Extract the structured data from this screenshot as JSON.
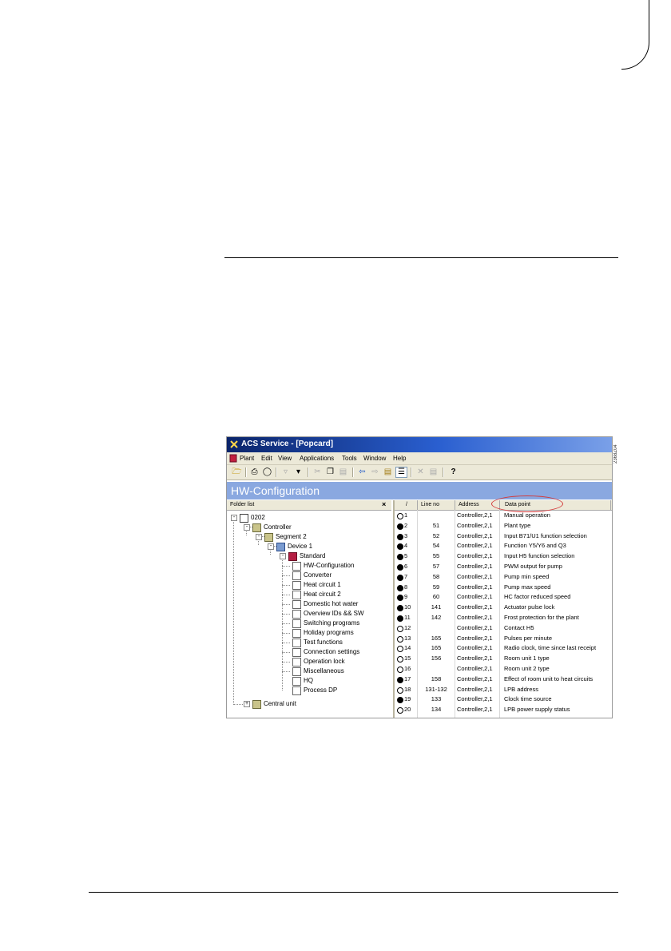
{
  "page": {
    "side_code": "2368Z04"
  },
  "window": {
    "title": "ACS Service - [Popcard]"
  },
  "menu": [
    "Plant",
    "Edit",
    "View",
    "Applications",
    "Tools",
    "Window",
    "Help"
  ],
  "toolbar_icons": [
    "open-icon",
    "print-icon",
    "print-preview-icon",
    "filter-icon",
    "filter-remove-icon",
    "cut-icon",
    "copy-icon",
    "paste-icon",
    "back-icon",
    "forward-icon",
    "folder-up-icon",
    "details-view-icon",
    "delete-icon",
    "properties-icon",
    "help-icon"
  ],
  "view": {
    "header": "HW-Configuration"
  },
  "folder_list": {
    "label": "Folder list",
    "close_glyph": "×",
    "nodes": [
      {
        "label": "0202",
        "icon": "plant"
      },
      {
        "label": "Controller",
        "icon": "ctrl"
      },
      {
        "label": "Segment 2",
        "icon": "ctrl"
      },
      {
        "label": "Device 1",
        "icon": "dev"
      },
      {
        "label": "Standard",
        "icon": "std"
      },
      {
        "label": "HW-Configuration",
        "icon": "page"
      },
      {
        "label": "Converter",
        "icon": "page"
      },
      {
        "label": "Heat circuit 1",
        "icon": "page"
      },
      {
        "label": "Heat circuit 2",
        "icon": "page"
      },
      {
        "label": "Domestic hot water",
        "icon": "page"
      },
      {
        "label": "Overview IDs && SW",
        "icon": "page"
      },
      {
        "label": "Switching programs",
        "icon": "page"
      },
      {
        "label": "Holiday programs",
        "icon": "page"
      },
      {
        "label": "Test functions",
        "icon": "page"
      },
      {
        "label": "Connection settings",
        "icon": "page"
      },
      {
        "label": "Operation lock",
        "icon": "page"
      },
      {
        "label": "Miscellaneous",
        "icon": "page"
      },
      {
        "label": "HQ",
        "icon": "page"
      },
      {
        "label": "Process DP",
        "icon": "page"
      },
      {
        "label": "Central unit",
        "icon": "ctrl"
      }
    ]
  },
  "grid": {
    "columns": [
      "/",
      "Line no",
      "Address",
      "Data point"
    ],
    "rows": [
      {
        "filled": false,
        "idx": "1",
        "line": "",
        "addr": "Controller,2,1",
        "dp": "Manual operation"
      },
      {
        "filled": true,
        "idx": "2",
        "line": "51",
        "addr": "Controller,2,1",
        "dp": "Plant type"
      },
      {
        "filled": true,
        "idx": "3",
        "line": "52",
        "addr": "Controller,2,1",
        "dp": "Input B71/U1 function selection"
      },
      {
        "filled": true,
        "idx": "4",
        "line": "54",
        "addr": "Controller,2,1",
        "dp": "Function Y5/Y6 and Q3"
      },
      {
        "filled": true,
        "idx": "5",
        "line": "55",
        "addr": "Controller,2,1",
        "dp": "Input H5 function selection"
      },
      {
        "filled": true,
        "idx": "6",
        "line": "57",
        "addr": "Controller,2,1",
        "dp": "PWM output for pump"
      },
      {
        "filled": true,
        "idx": "7",
        "line": "58",
        "addr": "Controller,2,1",
        "dp": "Pump min speed"
      },
      {
        "filled": true,
        "idx": "8",
        "line": "59",
        "addr": "Controller,2,1",
        "dp": "Pump max speed"
      },
      {
        "filled": true,
        "idx": "9",
        "line": "60",
        "addr": "Controller,2,1",
        "dp": "HC factor reduced speed"
      },
      {
        "filled": true,
        "idx": "10",
        "line": "141",
        "addr": "Controller,2,1",
        "dp": "Actuator pulse lock"
      },
      {
        "filled": true,
        "idx": "11",
        "line": "142",
        "addr": "Controller,2,1",
        "dp": "Frost protection for the plant"
      },
      {
        "filled": false,
        "idx": "12",
        "line": "",
        "addr": "Controller,2,1",
        "dp": "Contact H5"
      },
      {
        "filled": false,
        "idx": "13",
        "line": "165",
        "addr": "Controller,2,1",
        "dp": "Pulses per minute"
      },
      {
        "filled": false,
        "idx": "14",
        "line": "165",
        "addr": "Controller,2,1",
        "dp": "Radio clock, time since last receipt"
      },
      {
        "filled": false,
        "idx": "15",
        "line": "156",
        "addr": "Controller,2,1",
        "dp": "Room unit 1 type"
      },
      {
        "filled": false,
        "idx": "16",
        "line": "",
        "addr": "Controller,2,1",
        "dp": "Room unit 2 type"
      },
      {
        "filled": true,
        "idx": "17",
        "line": "158",
        "addr": "Controller,2,1",
        "dp": "Effect of room unit to heat circuits"
      },
      {
        "filled": false,
        "idx": "18",
        "line": "131-132",
        "addr": "Controller,2,1",
        "dp": "LPB address"
      },
      {
        "filled": true,
        "idx": "19",
        "line": "133",
        "addr": "Controller,2,1",
        "dp": "Clock time source"
      },
      {
        "filled": false,
        "idx": "20",
        "line": "134",
        "addr": "Controller,2,1",
        "dp": "LPB power supply status"
      }
    ]
  }
}
